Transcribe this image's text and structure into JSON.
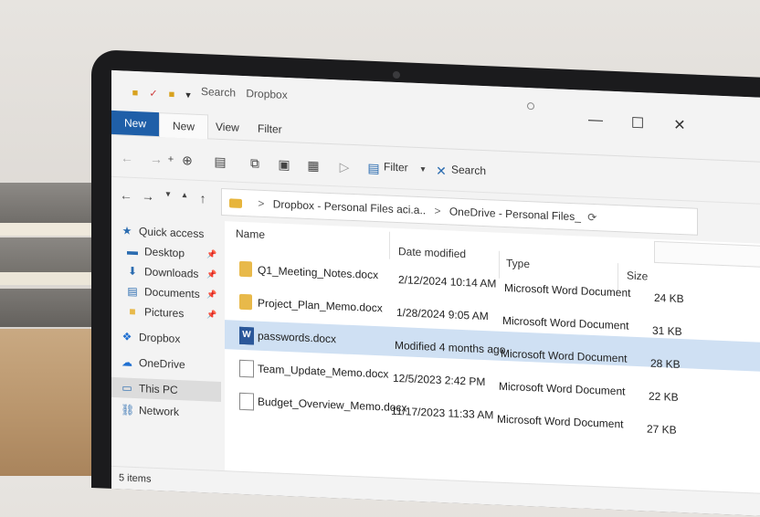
{
  "window": {
    "title_search": "Search",
    "title_location": "Dropbox",
    "controls": [
      "—",
      "☐",
      "✕"
    ]
  },
  "ribbon": {
    "tabs": [
      "New",
      "New",
      "View",
      "Filter"
    ]
  },
  "toolbar": {
    "filter_label": "Filter",
    "search_label": "Search"
  },
  "address": {
    "part1": "Dropbox - Personal Files aci.a..",
    "part2": "OneDrive - Personal Files_",
    "sep": ">"
  },
  "sidebar": {
    "items": [
      {
        "label": "Quick access",
        "icon": "star-icon"
      },
      {
        "label": "Desktop",
        "icon": "desktop-icon"
      },
      {
        "label": "Downloads",
        "icon": "download-icon"
      },
      {
        "label": "Documents",
        "icon": "documents-icon"
      },
      {
        "label": "Pictures",
        "icon": "folder-icon"
      },
      {
        "label": "Dropbox",
        "icon": "dropbox-icon"
      },
      {
        "label": "OneDrive",
        "icon": "cloud-icon"
      },
      {
        "label": "This PC",
        "icon": "monitor-icon"
      },
      {
        "label": "Network",
        "icon": "network-icon"
      }
    ]
  },
  "columns": {
    "name": "Name",
    "date": "Date modified",
    "type": "Type",
    "size": "Size"
  },
  "files": [
    {
      "name": "Q1_Meeting_Notes.docx",
      "date": "2/12/2024 10:14 AM",
      "type": "Microsoft Word Document",
      "size": "24 KB"
    },
    {
      "name": "Project_Plan_Memo.docx",
      "date": "1/28/2024 9:05 AM",
      "type": "Microsoft Word Document",
      "size": "31 KB"
    },
    {
      "name": "passwords.docx",
      "date": "Modified 4 months ago",
      "type": "Microsoft Word Document",
      "size": "28 KB"
    },
    {
      "name": "Team_Update_Memo.docx",
      "date": "12/5/2023 2:42 PM",
      "type": "Microsoft Word Document",
      "size": "22 KB"
    },
    {
      "name": "Budget_Overview_Memo.docx",
      "date": "11/17/2023 11:33 AM",
      "type": "Microsoft Word Document",
      "size": "27 KB"
    }
  ],
  "status": {
    "count": "5 items"
  }
}
